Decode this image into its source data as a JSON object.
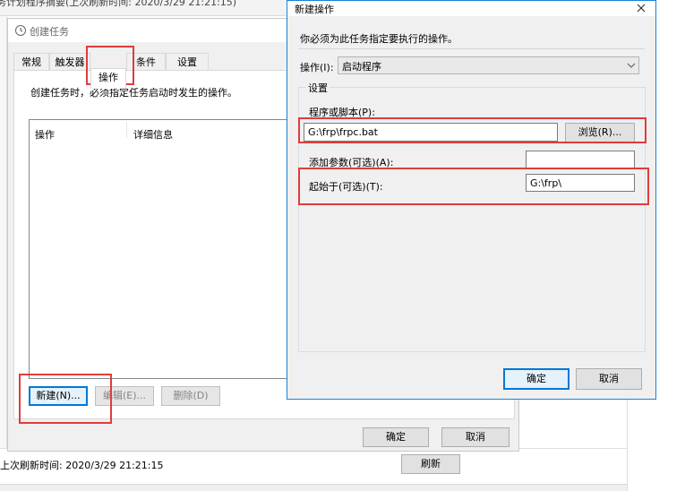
{
  "bg_window": {
    "title_strip": "务计划程序摘要(上次刷新时间: 2020/3/29 21:21:15)",
    "footer_refresh_text": "上次刷新时间: 2020/3/29 21:21:15",
    "refresh_button": "刷新"
  },
  "create_task": {
    "title": "创建任务",
    "tabs": [
      "常规",
      "触发器",
      "操作",
      "条件",
      "设置"
    ],
    "description": "创建任务时，必须指定任务启动时发生的操作。",
    "columns": [
      "操作",
      "详细信息"
    ],
    "buttons": {
      "new": "新建(N)...",
      "edit": "编辑(E)...",
      "delete": "删除(D)"
    },
    "ok": "确定",
    "cancel": "取消"
  },
  "new_action": {
    "title": "新建操作",
    "instruction": "你必须为此任务指定要执行的操作。",
    "action_label": "操作(I):",
    "action_value": "启动程序",
    "settings_group": "设置",
    "program_label": "程序或脚本(P):",
    "program_value": "G:\\frp\\frpc.bat",
    "browse": "浏览(R)...",
    "args_label": "添加参数(可选)(A):",
    "args_value": "",
    "start_in_label": "起始于(可选)(T):",
    "start_in_value": "G:\\frp\\",
    "ok": "确定",
    "cancel": "取消"
  },
  "colors": {
    "accent": "#0078d7",
    "highlight_red": "#e03c3c",
    "dialog_bg": "#f0f0f0"
  }
}
